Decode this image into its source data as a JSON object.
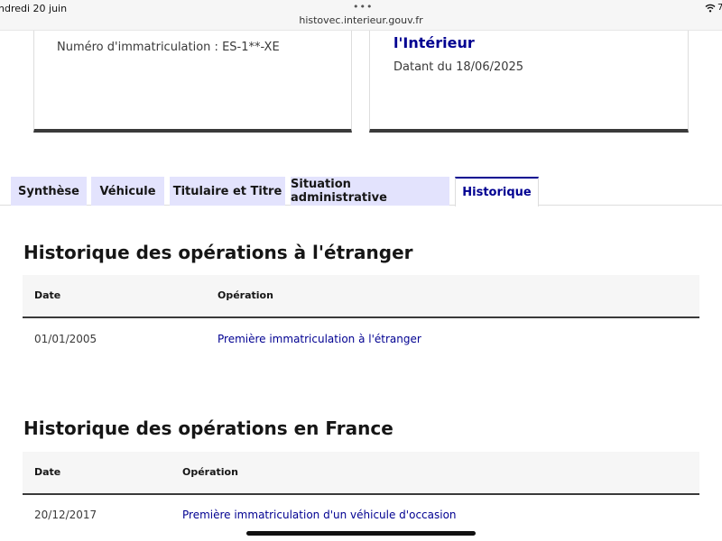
{
  "status_bar": {
    "time": "ndredi 20 juin",
    "dots": "•••",
    "url": "histovec.interieur.gouv.fr",
    "battery": "7"
  },
  "cards": {
    "left": {
      "registration": "Numéro d'immatriculation : ES-1**-XE"
    },
    "right": {
      "title": "l'Intérieur",
      "date": "Datant du 18/06/2025"
    }
  },
  "tabs": [
    {
      "label": "Synthèse"
    },
    {
      "label": "Véhicule"
    },
    {
      "label": "Titulaire et Titre"
    },
    {
      "label": "Situation administrative"
    },
    {
      "label": "Historique"
    }
  ],
  "sections": {
    "foreign": {
      "title": "Historique des opérations à l'étranger",
      "columns": [
        "Date",
        "Opération"
      ],
      "rows": [
        {
          "date": "01/01/2005",
          "operation": "Première immatriculation à l'étranger"
        }
      ]
    },
    "france": {
      "title": "Historique des opérations en France",
      "columns": [
        "Date",
        "Opération"
      ],
      "rows": [
        {
          "date": "20/12/2017",
          "operation": "Première immatriculation d'un véhicule d'occasion"
        }
      ]
    }
  },
  "colors": {
    "accent": "#000091",
    "tab_background": "#e3e3fd",
    "table_header": "#f6f6f6"
  },
  "icons": {
    "wifi": "wifi-icon"
  }
}
